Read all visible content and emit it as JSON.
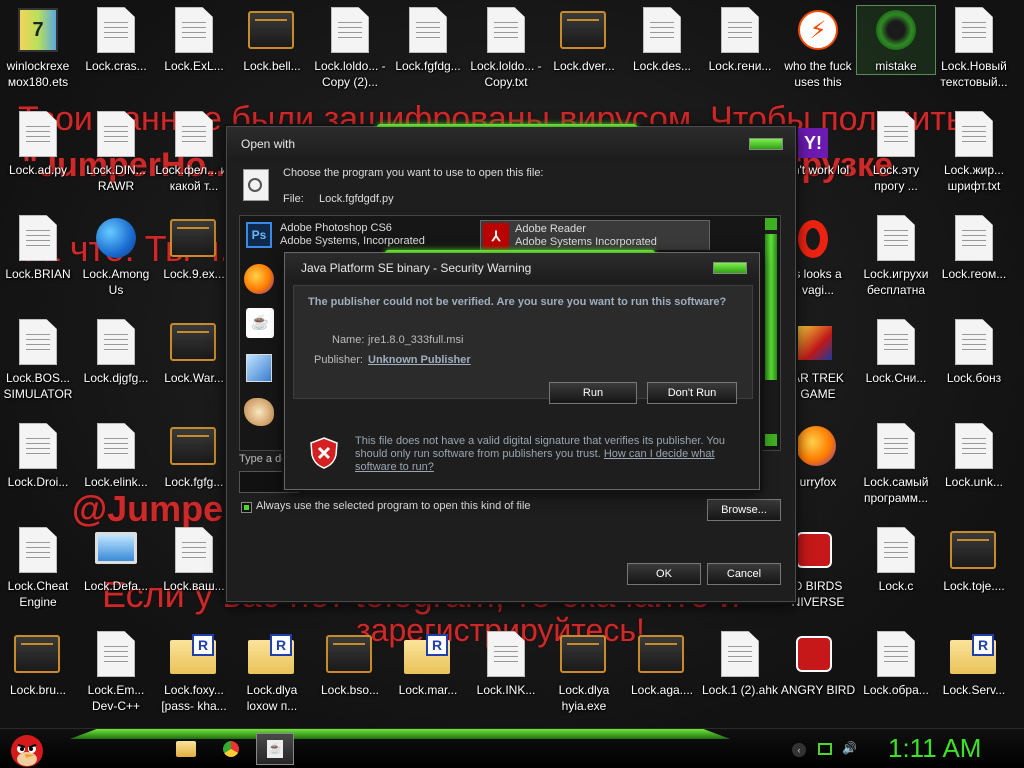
{
  "desktop": {
    "wallpaper_text": [
      "Твои данные были зашифрованы вирусом. Чтобы получить",
      "\"JumperHo...\" не пытайтесь удалить и вы выгрузке",
      "За что: Ты ч...  Как мне это",
      "@Jumpe...  8128 вам",
      "Если у вас нет telegram, то скачайте и",
      "зарегистрируйтесь!"
    ],
    "icons": [
      {
        "label": "winlockrexe мох180.ets",
        "type": "zip"
      },
      {
        "label": "Lock.cras...",
        "type": "doc"
      },
      {
        "label": "Lock.ExL...",
        "type": "doc"
      },
      {
        "label": "Lock.bell...",
        "type": "scr"
      },
      {
        "label": "Lock.loldo... - Copy (2)...",
        "type": "doc"
      },
      {
        "label": "Lock.fgfdg...",
        "type": "doc"
      },
      {
        "label": "Lock.loldo... - Copy.txt",
        "type": "doc"
      },
      {
        "label": "Lock.dver...",
        "type": "scr"
      },
      {
        "label": "Lock.des...",
        "type": "doc"
      },
      {
        "label": "Lock.гени...",
        "type": "doc"
      },
      {
        "label": "who the fuck uses this",
        "type": "bolt"
      },
      {
        "label": "mistake",
        "type": "green"
      },
      {
        "label": "Lock.Новый текстовый...",
        "type": "doc"
      },
      {
        "label": "Lock.ad.py",
        "type": "doc"
      },
      {
        "label": "Lock.DIN... RAWR",
        "type": "doc"
      },
      {
        "label": "Lock.фел... из какой т...",
        "type": "doc"
      },
      {
        "label": "sn't work lol",
        "type": "yahoo"
      },
      {
        "label": "Lock.эту прогу ...",
        "type": "doc"
      },
      {
        "label": "Lock.жир... шрифт.txt",
        "type": "doc"
      },
      {
        "label": "Lock.BRIAN",
        "type": "doc"
      },
      {
        "label": "Lock.Among Us",
        "type": "globe"
      },
      {
        "label": "Lock.9.ex...",
        "type": "scr"
      },
      {
        "label": "s looks a vagi...",
        "type": "opera"
      },
      {
        "label": "Lock.игрухи бесплатна",
        "type": "doc"
      },
      {
        "label": "Lock.геом...",
        "type": "doc"
      },
      {
        "label": "Lock.BOS... SIMULATOR",
        "type": "doc"
      },
      {
        "label": "Lock.djgfg...",
        "type": "doc"
      },
      {
        "label": "Lock.War...",
        "type": "scr"
      },
      {
        "label": "AR TREK GAME",
        "type": "game"
      },
      {
        "label": "Lock.Сни...",
        "type": "doc"
      },
      {
        "label": "Lock.бонз",
        "type": "doc"
      },
      {
        "label": "Lock.Droi...",
        "type": "doc"
      },
      {
        "label": "Lock.elink...",
        "type": "doc"
      },
      {
        "label": "Lock.fgfg...",
        "type": "scr"
      },
      {
        "label": "urryfox",
        "type": "firefox"
      },
      {
        "label": "Lock.самый программ...",
        "type": "doc"
      },
      {
        "label": "Lock.unk...",
        "type": "doc"
      },
      {
        "label": "Lock.Cheat Engine",
        "type": "doc"
      },
      {
        "label": "Lock.Defa...",
        "type": "rdp"
      },
      {
        "label": "Lock.ваш...",
        "type": "doc"
      },
      {
        "label": "D BIRDS NIVERSE",
        "type": "birds"
      },
      {
        "label": "Lock.c",
        "type": "doc"
      },
      {
        "label": "Lock.toje....",
        "type": "scr"
      },
      {
        "label": "Lock.bru...",
        "type": "scr"
      },
      {
        "label": "Lock.Em... Dev-C++",
        "type": "doc"
      },
      {
        "label": "Lock.foxy... [pass- kha...",
        "type": "folder"
      },
      {
        "label": "Lock.dlya loxow п...",
        "type": "folder"
      },
      {
        "label": "Lock.bso...",
        "type": "scr"
      },
      {
        "label": "Lock.mar...",
        "type": "folder"
      },
      {
        "label": "Lock.INK...",
        "type": "doc"
      },
      {
        "label": "Lock.dlya hyia.exe",
        "type": "scr"
      },
      {
        "label": "Lock.aga....",
        "type": "scr"
      },
      {
        "label": "Lock.1 (2).ahk",
        "type": "doc"
      },
      {
        "label": "ANGRY BIRD",
        "type": "birds"
      },
      {
        "label": "Lock.обра...",
        "type": "doc"
      },
      {
        "label": "Lock.Serv...",
        "type": "folder"
      }
    ]
  },
  "open_with": {
    "title": "Open with",
    "prompt": "Choose the program you want to use to open this file:",
    "file_label": "File:",
    "file_name": "Lock.fgfdgdf.py",
    "programs": [
      {
        "name": "Adobe Photoshop CS6",
        "company": "Adobe Systems, Incorporated"
      },
      {
        "name": "Adobe Reader",
        "company": "Adobe Systems Incorporated"
      }
    ],
    "type_desc": "Type a de",
    "checkbox_label": "Always use the selected program to open this kind of file",
    "browse": "Browse...",
    "ok": "OK",
    "cancel": "Cancel"
  },
  "security": {
    "title": "Java Platform SE binary - Security Warning",
    "heading": "The publisher could not be verified.  Are you sure you want to run this software?",
    "name_label": "Name:",
    "name_value": "jre1.8.0_333full.msi",
    "publisher_label": "Publisher:",
    "publisher_value": "Unknown Publisher",
    "run": "Run",
    "dont_run": "Don't Run",
    "warning_text": "This file does not have a valid digital signature that verifies its publisher. You should only run software from publishers you trust.",
    "warning_link": "How can I decide what software to run?"
  },
  "taskbar": {
    "clock": "1:11 AM"
  }
}
